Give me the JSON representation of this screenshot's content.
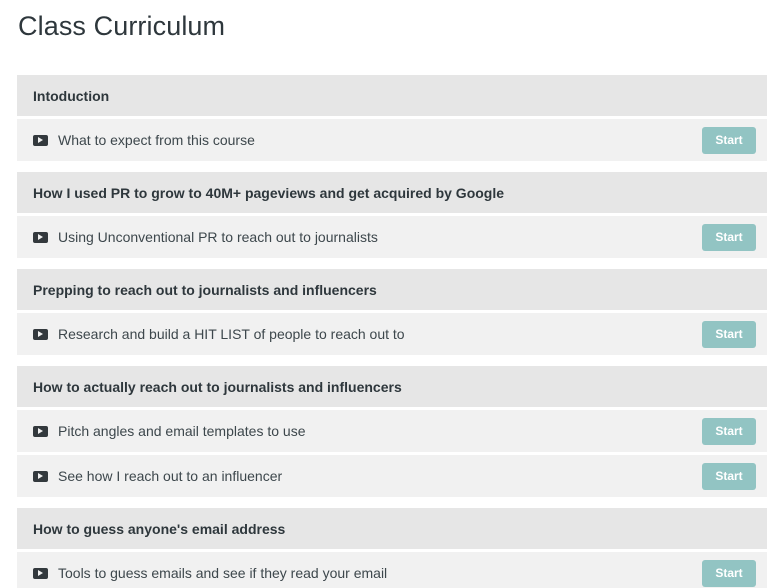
{
  "page": {
    "title": "Class Curriculum"
  },
  "sections": [
    {
      "title": "Intoduction",
      "lectures": [
        {
          "title": "What to expect from this course",
          "icon": "play-video-icon",
          "button": "Start"
        }
      ]
    },
    {
      "title": "How I used PR to grow to 40M+ pageviews and get acquired by Google",
      "lectures": [
        {
          "title": "Using Unconventional PR to reach out to journalists",
          "icon": "play-video-icon",
          "button": "Start"
        }
      ]
    },
    {
      "title": "Prepping to reach out to journalists and influencers",
      "lectures": [
        {
          "title": "Research and build a HIT LIST of people to reach out to",
          "icon": "play-video-icon",
          "button": "Start"
        }
      ]
    },
    {
      "title": "How to actually reach out to journalists and influencers",
      "lectures": [
        {
          "title": "Pitch angles and email templates to use",
          "icon": "play-video-icon",
          "button": "Start"
        },
        {
          "title": "See how I reach out to an influencer",
          "icon": "play-video-icon",
          "button": "Start"
        }
      ]
    },
    {
      "title": "How to guess anyone's email address",
      "lectures": [
        {
          "title": "Tools to guess emails and see if they read your email",
          "icon": "play-video-icon",
          "button": "Start"
        }
      ]
    }
  ],
  "colors": {
    "section_header_bg": "#e6e6e6",
    "lecture_row_bg": "#f1f1f1",
    "start_button_bg": "#92c4c3",
    "title_text": "#2e373c"
  }
}
